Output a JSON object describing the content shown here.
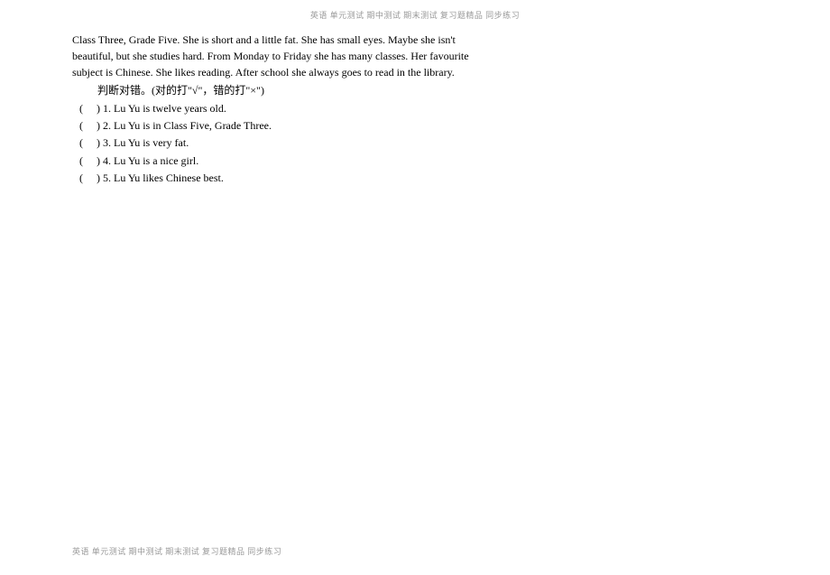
{
  "header": {
    "text": "英语  单元测试  期中测试  期末测试  复习题精品  同步练习"
  },
  "passage": {
    "line1": "Class Three, Grade Five. She is short and a little fat. She has small eyes. Maybe she isn't",
    "line2": "beautiful, but she studies hard. From Monday to Friday she has many classes. Her favourite",
    "line3": "subject is Chinese. She likes reading. After school she always goes to read in the library."
  },
  "instruction": "判断对错。(对的打\"√\"，错的打\"×\")",
  "paren_open": "(",
  "paren_close": ")",
  "questions": [
    {
      "num": "1.",
      "text": "Lu Yu is twelve years old."
    },
    {
      "num": "2.",
      "text": "Lu Yu is in Class Five, Grade Three."
    },
    {
      "num": "3.",
      "text": "Lu Yu is very fat."
    },
    {
      "num": "4.",
      "text": "Lu Yu is a nice girl."
    },
    {
      "num": "5.",
      "text": "Lu Yu likes Chinese best."
    }
  ],
  "footer": {
    "text": "英语  单元测试  期中测试  期末测试  复习题精品  同步练习"
  }
}
